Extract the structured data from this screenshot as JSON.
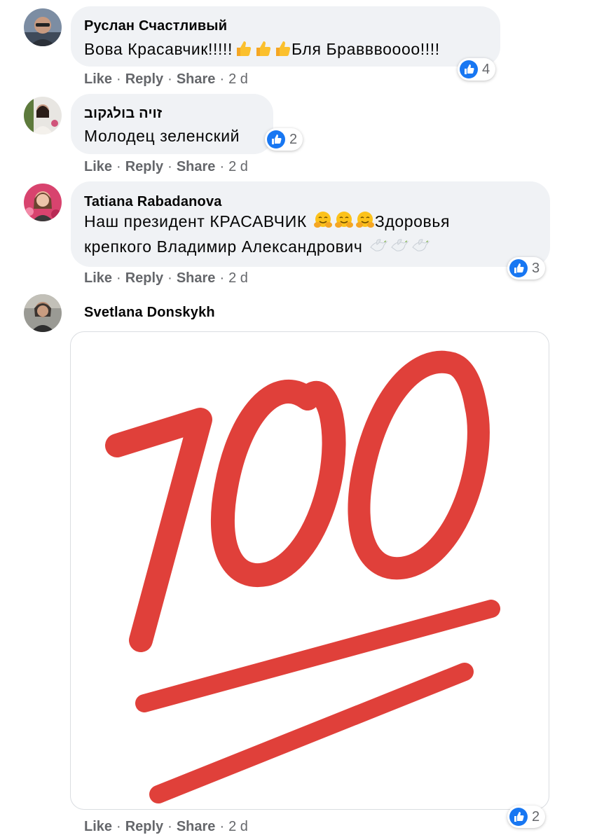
{
  "comments": [
    {
      "author": "Руслан Счастливый",
      "text_before": "Вова Красавчик!!!!!",
      "text_after": "Бля Бравввоооо!!!!",
      "emoji": "thumbs-up-emoji",
      "reaction_count": "4",
      "time": "2 d"
    },
    {
      "author": "זויה בולגקוב",
      "text": "Молодец зеленский",
      "reaction_count": "2",
      "time": "2 d"
    },
    {
      "author": "Tatiana Rabadanova",
      "line1": "Наш президент КРАСАВЧИК",
      "line1_after": "Здоровья",
      "line2": "крепкого Владимир Александрович",
      "emoji": [
        "hug-emoji",
        "dove-emoji"
      ],
      "reaction_count": "3",
      "time": "2 d"
    },
    {
      "author": "Svetlana Donskykh",
      "sticker": "hundred-points-sticker",
      "reaction_count": "2",
      "time": "2 d"
    }
  ],
  "actions": {
    "like": "Like",
    "reply": "Reply",
    "share": "Share",
    "separator": "·"
  },
  "colors": {
    "bubble": "#f0f2f5",
    "meta_text": "#65676b",
    "like_blue": "#1877f2",
    "sticker_red": "#e0403a"
  }
}
